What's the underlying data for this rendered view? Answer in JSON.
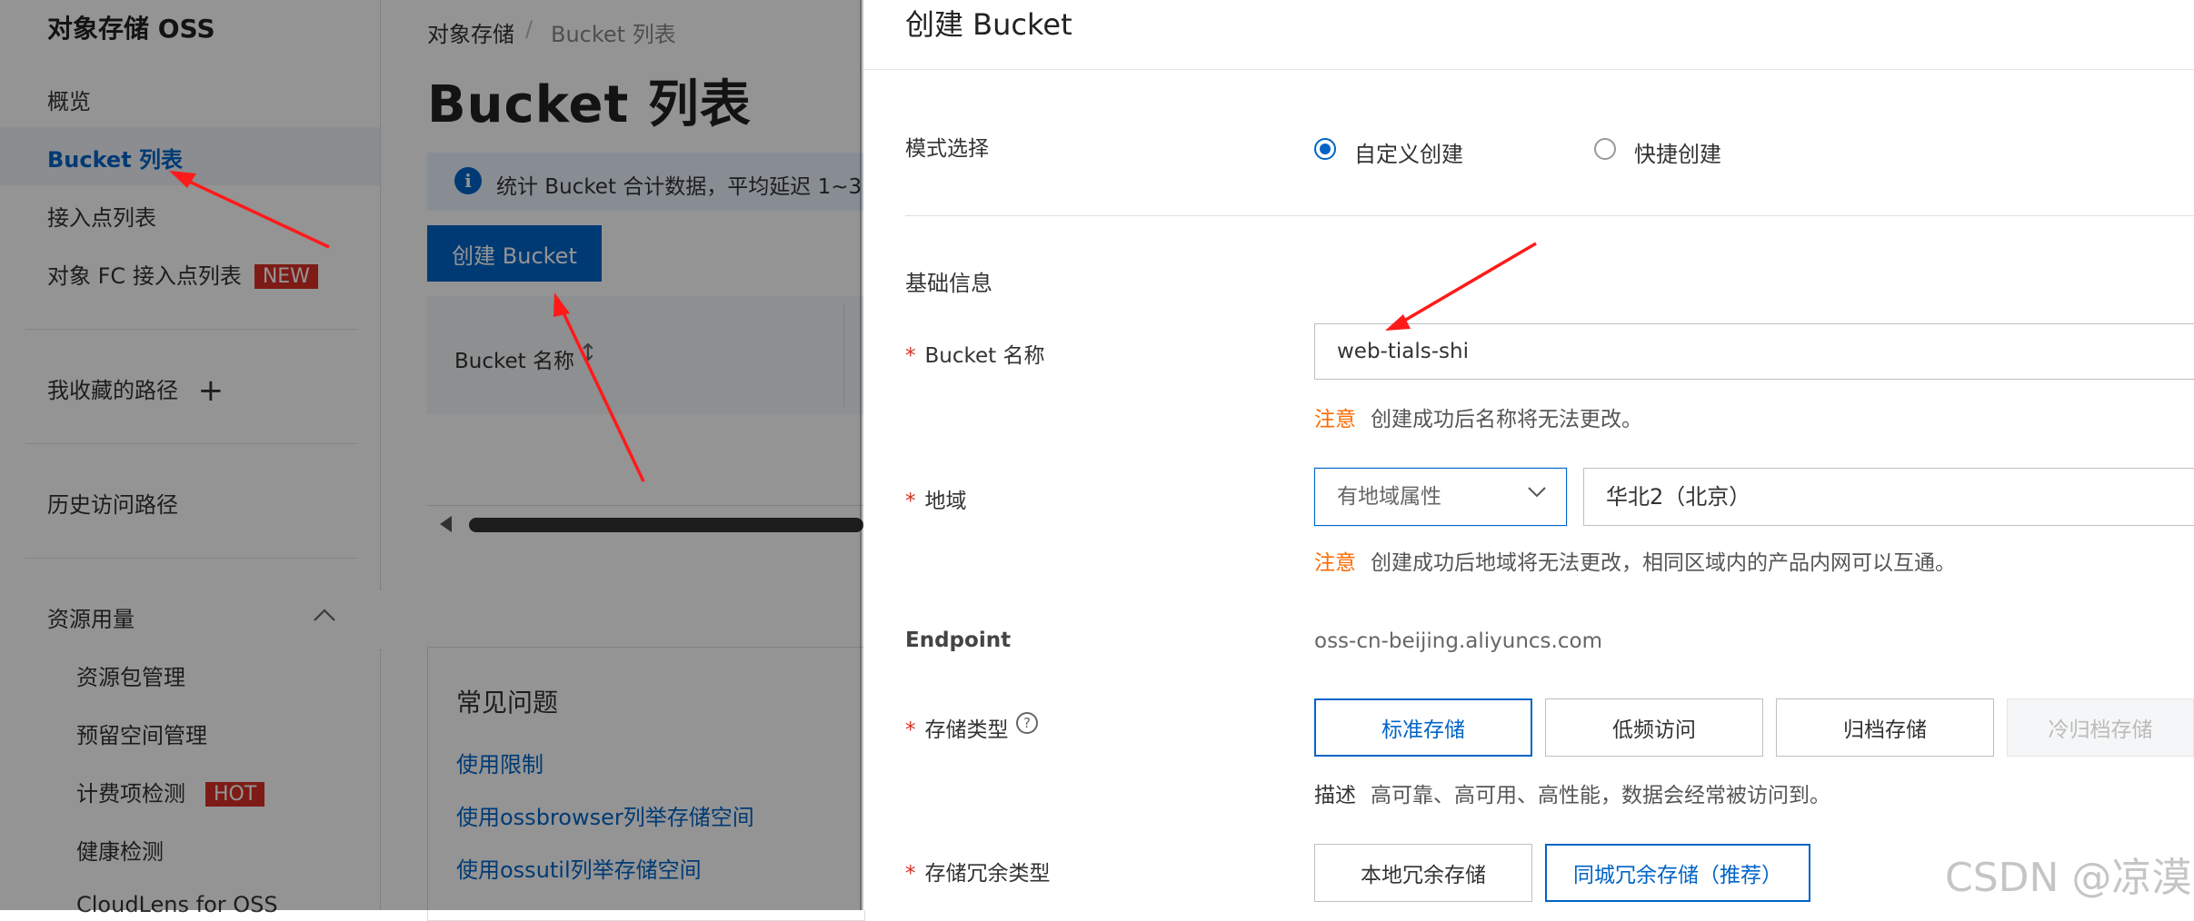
{
  "sidebar": {
    "title": "对象存储 OSS",
    "items": {
      "overview": "概览",
      "bucket_list": "Bucket 列表",
      "access_points": "接入点列表",
      "fc_access_points": "对象 FC 接入点列表",
      "fc_tag": "NEW",
      "favorites": "我收藏的路径",
      "history": "历史访问路径",
      "resources": "资源用量",
      "resource_pkg": "资源包管理",
      "reserved_space": "预留空间管理",
      "billing_check": "计费项检测",
      "billing_tag": "HOT",
      "health_check": "健康检测",
      "cloudlens": "CloudLens for OSS"
    }
  },
  "main": {
    "breadcrumb": [
      "对象存储",
      "/",
      "Bucket 列表"
    ],
    "title": "Bucket 列表",
    "info_text": "统计 Bucket 合计数据，平均延迟 1~3",
    "create_button": "创建 Bucket",
    "column_bucket_name": "Bucket 名称",
    "faq": {
      "title": "常见问题",
      "links": [
        "使用限制",
        "使用ossbrowser列举存储空间",
        "使用ossutil列举存储空间"
      ]
    }
  },
  "drawer": {
    "title": "创建 Bucket",
    "mode": {
      "label": "模式选择",
      "options": [
        "自定义创建",
        "快捷创建"
      ],
      "selected": "自定义创建"
    },
    "section_basic": "基础信息",
    "bucket_name": {
      "label": "Bucket 名称",
      "value": "web-tials-shi",
      "note_tag": "注意",
      "note": "创建成功后名称将无法更改。"
    },
    "region": {
      "label": "地域",
      "select": "有地域属性",
      "value": "华北2（北京）",
      "note_tag": "注意",
      "note": "创建成功后地域将无法更改，相同区域内的产品内网可以互通。"
    },
    "endpoint": {
      "label": "Endpoint",
      "value": "oss-cn-beijing.aliyuncs.com"
    },
    "storage_class": {
      "label": "存储类型",
      "help": "?",
      "options": [
        "标准存储",
        "低频访问",
        "归档存储",
        "冷归档存储"
      ],
      "selected": "标准存储",
      "desc_key": "描述",
      "desc": "高可靠、高可用、高性能，数据会经常被访问到。"
    },
    "redundancy": {
      "label": "存储冗余类型",
      "options": [
        "本地冗余存储",
        "同城冗余存储（推荐）"
      ],
      "selected": "同城冗余存储（推荐）"
    },
    "required_mark": "*"
  },
  "watermark": "CSDN @凉漠",
  "colors": {
    "primary": "#0064c8",
    "warning": "#ff6a00",
    "tag_red": "#d93026",
    "annotation_arrow": "#ff1a1a"
  }
}
